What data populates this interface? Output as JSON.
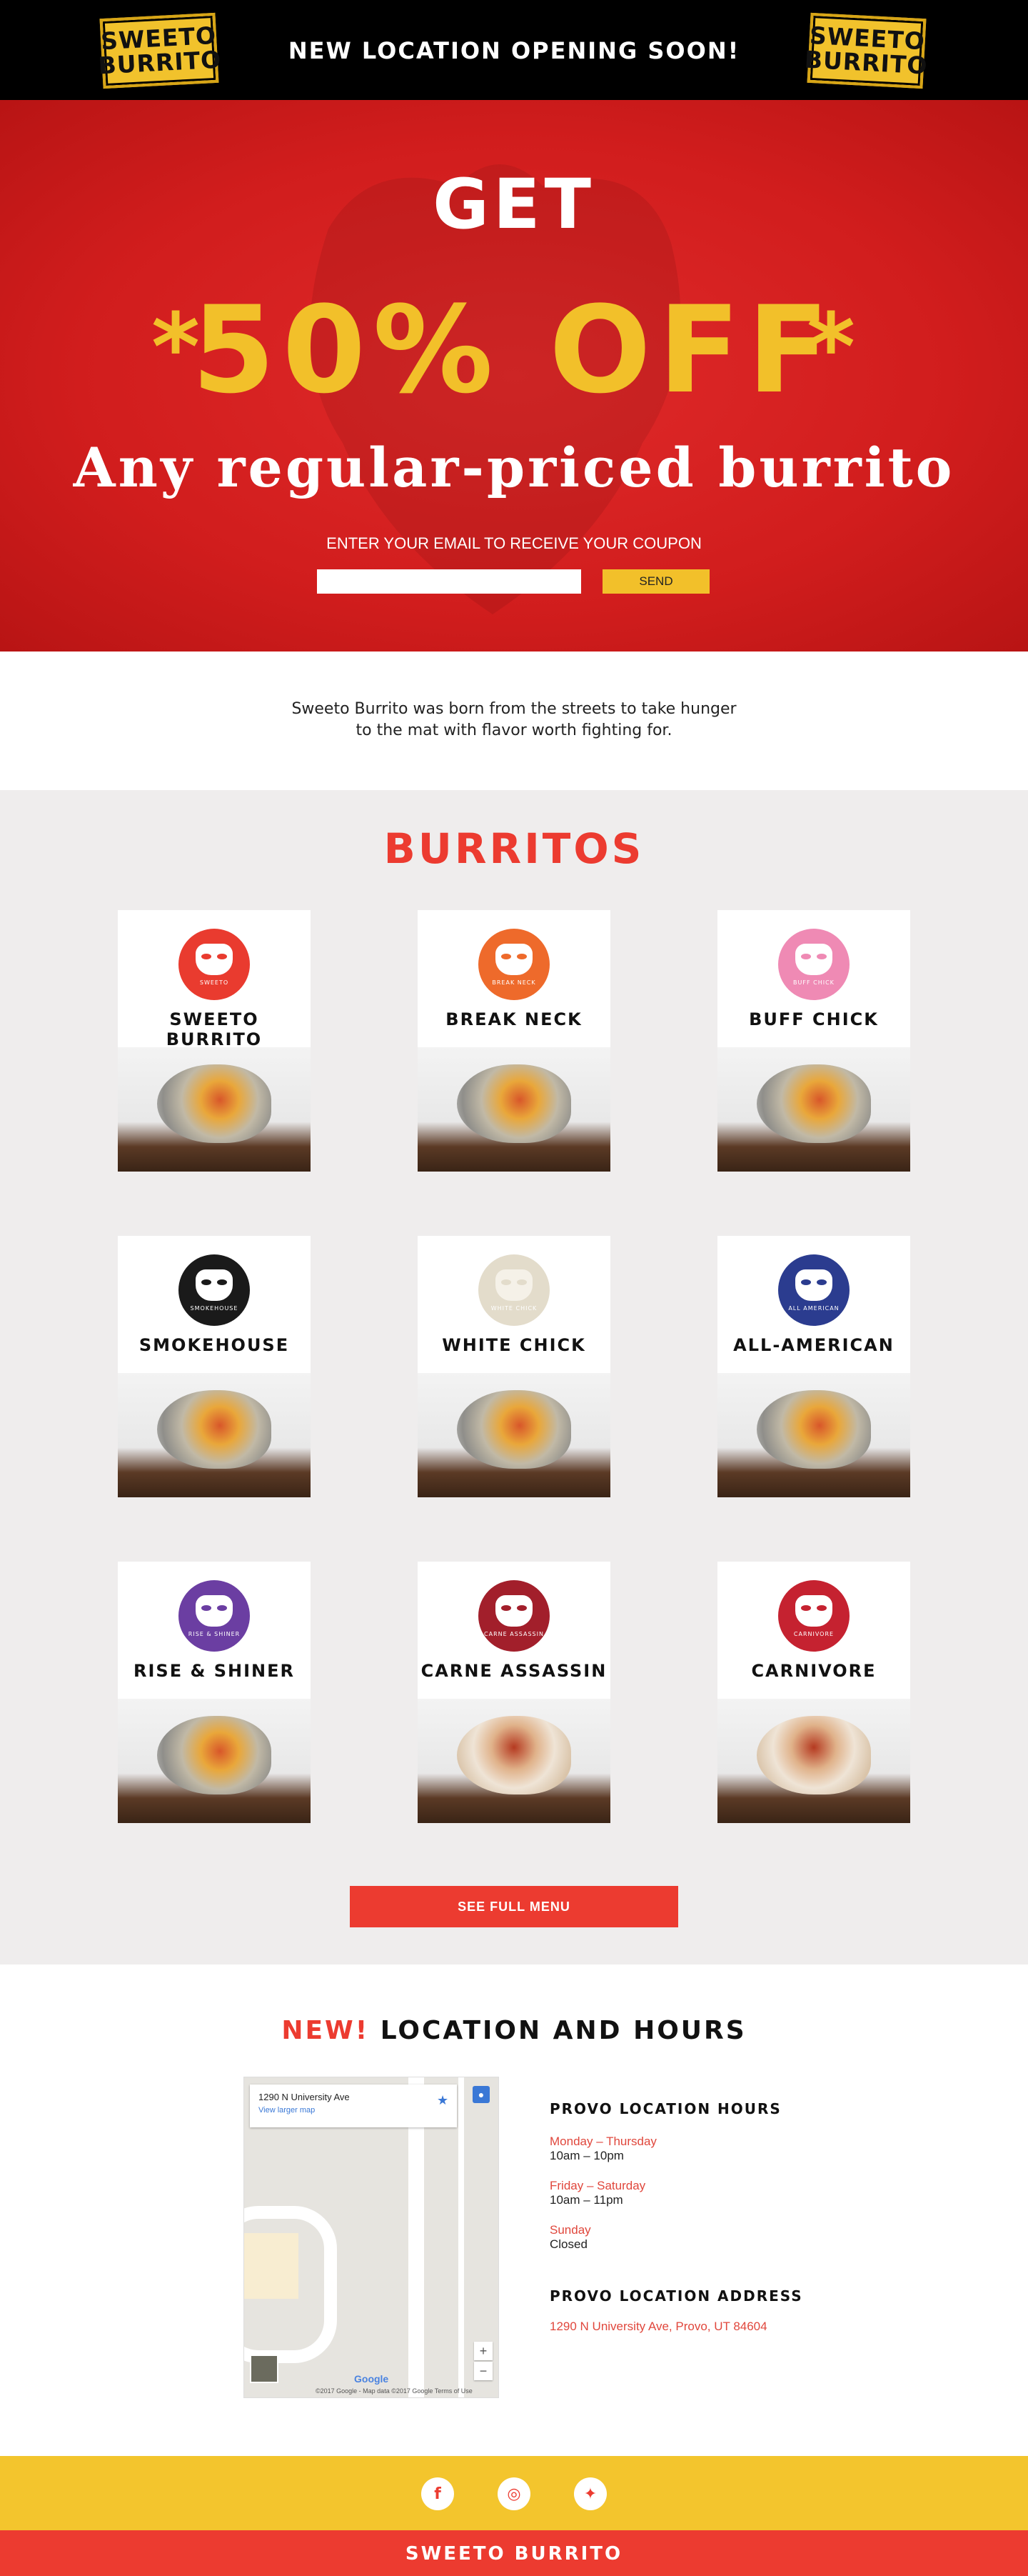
{
  "header": {
    "logo_line1": "SWEETO",
    "logo_line2": "BURRITO",
    "title": "NEW LOCATION OPENING SOON!"
  },
  "hero": {
    "get": "GET",
    "offer": "50% OFF",
    "star": "*",
    "subtitle": "Any regular-priced burrito",
    "prompt": "ENTER YOUR EMAIL TO RECEIVE YOUR COUPON",
    "email_value": "",
    "send_label": "SEND"
  },
  "intro": {
    "line1": "Sweeto Burrito was born from the streets to take hunger",
    "line2": "to the mat with flavor worth fighting for."
  },
  "burritos": {
    "title": "BURRITOS",
    "items": [
      {
        "name": "SWEETO BURRITO",
        "badge_text": "SWEETO",
        "color": "#e93b2f"
      },
      {
        "name": "BREAK NECK",
        "badge_text": "BREAK NECK",
        "color": "#ee6a2b"
      },
      {
        "name": "BUFF CHICK",
        "badge_text": "BUFF CHICK",
        "color": "#ef8ab4"
      },
      {
        "name": "SMOKEHOUSE",
        "badge_text": "SMOKEHOUSE",
        "color": "#1a1a1a"
      },
      {
        "name": "WHITE CHICK",
        "badge_text": "WHITE CHICK",
        "color": "#e3dccb"
      },
      {
        "name": "ALL-AMERICAN",
        "badge_text": "ALL AMERICAN",
        "color": "#2b3c8f"
      },
      {
        "name": "RISE & SHINER",
        "badge_text": "RISE & SHINER",
        "color": "#6b3ea2"
      },
      {
        "name": "CARNE ASSASSIN",
        "badge_text": "CARNE ASSASSIN",
        "color": "#a21f2b"
      },
      {
        "name": "CARNIVORE",
        "badge_text": "CARNIVORE",
        "color": "#c52230"
      }
    ],
    "full_menu_label": "SEE FULL MENU"
  },
  "location": {
    "title_new": "NEW!",
    "title_rest": " LOCATION AND HOURS",
    "map": {
      "address": "1290 N University Ave",
      "view_larger": "View larger map",
      "zoom_in": "+",
      "zoom_out": "−",
      "google": "Google",
      "credit": "©2017 Google - Map data ©2017 Google    Terms of Use"
    },
    "hours_heading": "PROVO LOCATION HOURS",
    "hours": [
      {
        "days": "Monday – Thursday",
        "time": "10am – 10pm"
      },
      {
        "days": "Friday – Saturday",
        "time": "10am – 11pm"
      },
      {
        "days": "Sunday",
        "time": "Closed"
      }
    ],
    "address_heading": "PROVO LOCATION ADDRESS",
    "address": "1290 N University Ave, Provo, UT 84604"
  },
  "footer": {
    "brand": "SWEETO BURRITO",
    "social_icons": [
      "facebook-icon",
      "instagram-icon",
      "twitter-icon"
    ]
  },
  "colors": {
    "red": "#ec3b30",
    "yellow": "#f2c02a",
    "black": "#000000",
    "gray_bg": "#efeded"
  }
}
